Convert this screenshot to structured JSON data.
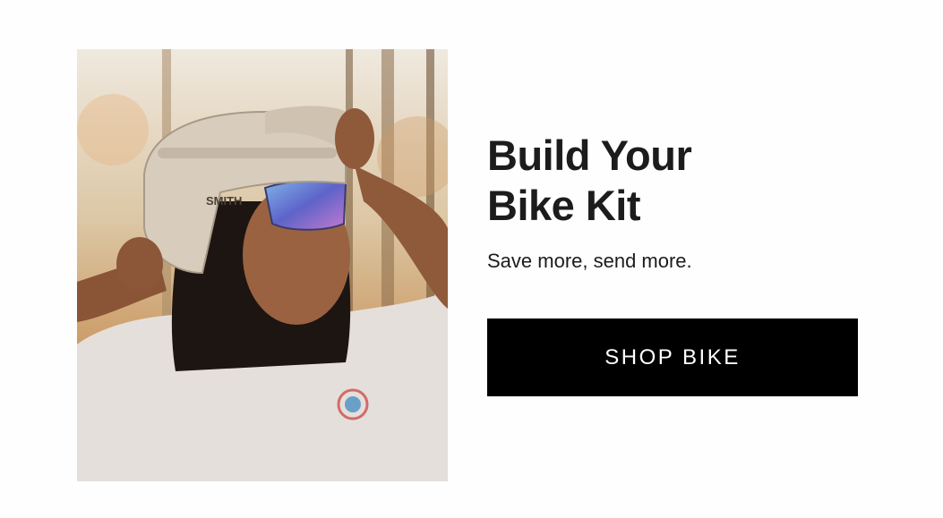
{
  "promo": {
    "headline_line1": "Build Your",
    "headline_line2": "Bike Kit",
    "subhead": "Save more, send more.",
    "cta_label": "SHOP BIKE",
    "image_alt": "Rider wearing a SMITH helmet and sunglasses",
    "helmet_brand": "SMITH"
  },
  "colors": {
    "background": "#fefefe",
    "text": "#1c1c1c",
    "button_bg": "#000000",
    "button_text": "#ffffff"
  }
}
